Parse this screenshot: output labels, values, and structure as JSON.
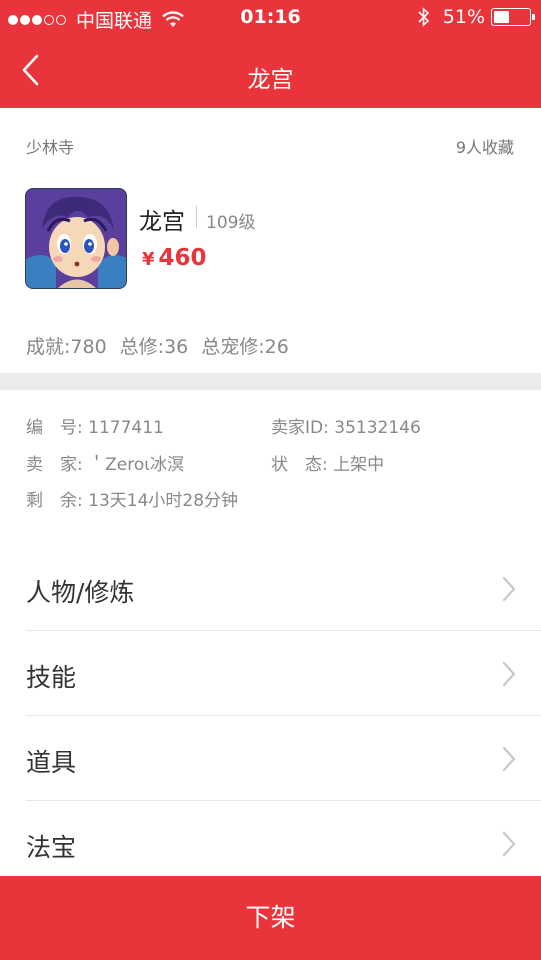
{
  "status_bar": {
    "carrier": "中国联通",
    "time": "01:16",
    "battery_percent": "51%",
    "battery_level": 0.51
  },
  "nav": {
    "title": "龙宫",
    "back_icon": "chevron-left-icon"
  },
  "header": {
    "server": "少林寺",
    "favorites": "9人收藏"
  },
  "character": {
    "name": "龙宫",
    "level": "109级",
    "currency_symbol": "¥",
    "price": "460"
  },
  "stats": {
    "achievement": "成就:780",
    "total_cultivation": "总修:36",
    "total_pet_cultivation": "总宠修:26"
  },
  "info": {
    "id_label": "编　号:",
    "id_value": "1177411",
    "seller_id_label": "卖家ID:",
    "seller_id_value": "35132146",
    "seller_label": "卖　家:",
    "seller_value": "＇Zeroι冰溟",
    "status_label": "状　态:",
    "status_value": "上架中",
    "remaining_label": "剩　余:",
    "remaining_value": "13天14小时28分钟"
  },
  "menu": [
    {
      "label": "人物/修炼"
    },
    {
      "label": "技能"
    },
    {
      "label": "道具"
    },
    {
      "label": "法宝"
    }
  ],
  "bottom_button": {
    "label": "下架"
  },
  "colors": {
    "brand_red": "#e8343a",
    "divider": "#ececec"
  }
}
